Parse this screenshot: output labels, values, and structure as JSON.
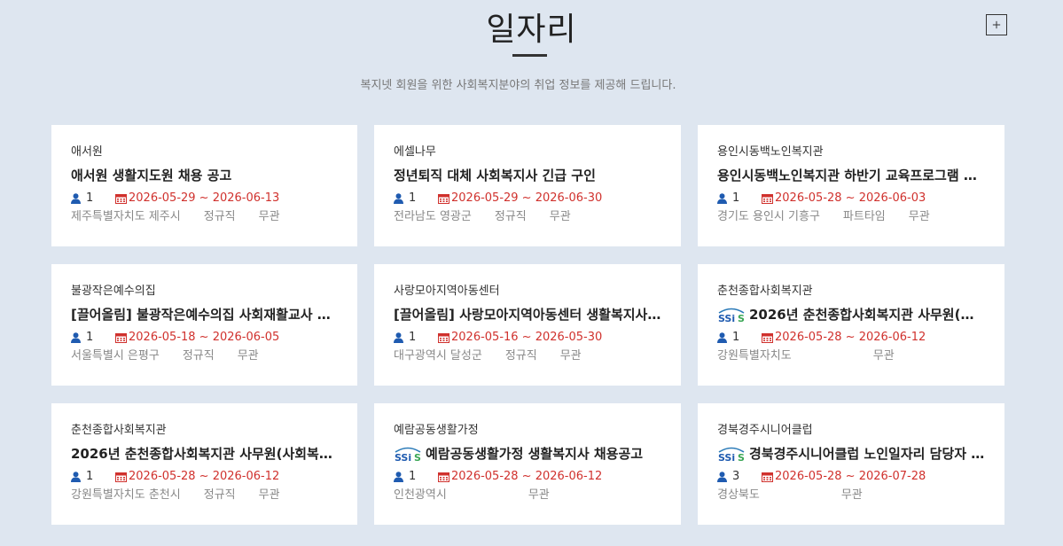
{
  "page": {
    "title": "일자리",
    "subtitle": "복지넷 회원을 위한 사회복지분야의 취업 정보를 제공해 드립니다.",
    "more_label": "+"
  },
  "cards": [
    {
      "org": "애서원",
      "title": "애서원 생활지도원 채용 공고",
      "logo": false,
      "count": "1",
      "dates": "2026-05-29 ~ 2026-06-13",
      "location": "제주특별자치도 제주시",
      "type": "정규직",
      "education": "무관"
    },
    {
      "org": "에셀나무",
      "title": "정년퇴직 대체 사회복지사 긴급 구인",
      "logo": false,
      "count": "1",
      "dates": "2026-05-29 ~ 2026-06-30",
      "location": "전라남도 영광군",
      "type": "정규직",
      "education": "무관"
    },
    {
      "org": "용인시동백노인복지관",
      "title": "용인시동백노인복지관 하반기 교육프로그램 강…",
      "logo": false,
      "count": "1",
      "dates": "2026-05-28 ~ 2026-06-03",
      "location": "경기도 용인시 기흥구",
      "type": "파트타임",
      "education": "무관"
    },
    {
      "org": "불광작은예수의집",
      "title": "[끌어올림] 불광작은예수의집 사회재활교사 채…",
      "logo": false,
      "count": "1",
      "dates": "2026-05-18 ~ 2026-06-05",
      "location": "서울특별시 은평구",
      "type": "정규직",
      "education": "무관"
    },
    {
      "org": "사랑모아지역아동센터",
      "title": "[끌어올림] 사랑모아지역아동센터 생활복지사 …",
      "logo": false,
      "count": "1",
      "dates": "2026-05-16 ~ 2026-05-30",
      "location": "대구광역시 달성군",
      "type": "정규직",
      "education": "무관"
    },
    {
      "org": "춘천종합사회복지관",
      "title": "2026년 춘천종합사회복지관 사무원(사회…",
      "logo": true,
      "count": "1",
      "dates": "2026-05-28 ~ 2026-06-12",
      "location": "강원특별자치도",
      "type": "",
      "education": "무관"
    },
    {
      "org": "춘천종합사회복지관",
      "title": "2026년 춘천종합사회복지관 사무원(사회복지…",
      "logo": false,
      "count": "1",
      "dates": "2026-05-28 ~ 2026-06-12",
      "location": "강원특별자치도 춘천시",
      "type": "정규직",
      "education": "무관"
    },
    {
      "org": "예람공동생활가정",
      "title": "예람공동생활가정 생활복지사 채용공고",
      "logo": true,
      "count": "1",
      "dates": "2026-05-28 ~ 2026-06-12",
      "location": "인천광역시",
      "type": "",
      "education": "무관"
    },
    {
      "org": "경북경주시니어클럽",
      "title": "경북경주시니어클럽 노인일자리 담당자 …",
      "logo": true,
      "count": "3",
      "dates": "2026-05-28 ~ 2026-07-28",
      "location": "경상북도",
      "type": "",
      "education": "무관"
    }
  ],
  "icons": {
    "person": "person-icon",
    "calendar": "calendar-icon",
    "logo": "ssis-logo"
  },
  "colors": {
    "background": "#dee6f0",
    "date": "#d0312d",
    "person": "#1f5bb0",
    "card": "#ffffff"
  }
}
